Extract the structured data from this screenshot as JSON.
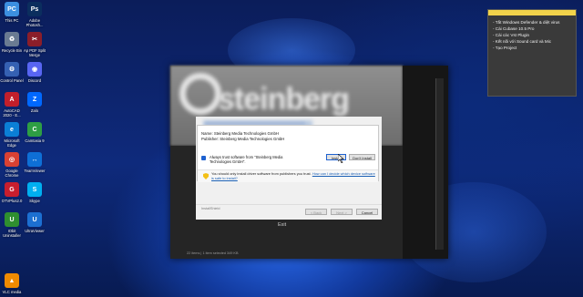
{
  "desktop": {
    "icons": [
      {
        "label": "This PC",
        "glyph": "PC",
        "color": "#3c8fe0"
      },
      {
        "label": "Adobe Photosh...",
        "glyph": "Ps",
        "color": "#0b2e5e"
      },
      {
        "label": "Recycle Bin",
        "glyph": "♻",
        "color": "#6a7b92"
      },
      {
        "label": "Ap PDF Split Merge",
        "glyph": "✂",
        "color": "#8b1e2a"
      },
      {
        "label": "Control Panel",
        "glyph": "⚙",
        "color": "#3561b3"
      },
      {
        "label": "Discord",
        "glyph": "◉",
        "color": "#5865f2"
      },
      {
        "label": "AutoCAD 2020 - E...",
        "glyph": "A",
        "color": "#c21f2b"
      },
      {
        "label": "Zalo",
        "glyph": "Z",
        "color": "#0068ff"
      },
      {
        "label": "Microsoft Edge",
        "glyph": "e",
        "color": "#0b7fd6"
      },
      {
        "label": "Camtasia 9",
        "glyph": "C",
        "color": "#2e9e44"
      },
      {
        "label": "Google Chrome",
        "glyph": "◎",
        "color": "#d94133"
      },
      {
        "label": "TeamViewer",
        "glyph": "↔",
        "color": "#0e6fd6"
      },
      {
        "label": "OTVPlus2.0",
        "glyph": "G",
        "color": "#c81e2e"
      },
      {
        "label": "Skype",
        "glyph": "S",
        "color": "#00aff0"
      },
      {
        "label": "IObit Uninstaller",
        "glyph": "U",
        "color": "#2f8f2f"
      },
      {
        "label": "UltraViewer",
        "glyph": "U",
        "color": "#1c6fd1"
      },
      {
        "label": "VLC media",
        "glyph": "▲",
        "color": "#f08a00"
      }
    ]
  },
  "sticky_note": {
    "items": [
      "- Tắt Windows Defender & diệt virus",
      "- Cài Cubase 10.5 Pro",
      "- Cài các Vst Plugin",
      "- Kết nối với Sound card và Mic",
      "- Tạo Project"
    ],
    "accent": "#f2d34a"
  },
  "installer": {
    "brand": "steinberg",
    "exit_label": "Exit",
    "status_line": "22 items  |  1 item selected  349 KB"
  },
  "setup_dialog": {
    "footer_brand": "InstallShield",
    "back_label": "< Back",
    "next_label": "Next >",
    "cancel_label": "Cancel"
  },
  "security_dialog": {
    "name_line": "Name: Steinberg Media Technologies GmbH",
    "publisher_line": "Publisher: Steinberg Media Technologies GmbH",
    "always_trust_label": "Always trust software from \"Steinberg Media Technologies GmbH\".",
    "install_label": "Install",
    "dont_install_label": "Don't Install",
    "warning_text": "You should only install driver software from publishers you trust.",
    "warning_link": "How can I decide which device software is safe to install?"
  }
}
